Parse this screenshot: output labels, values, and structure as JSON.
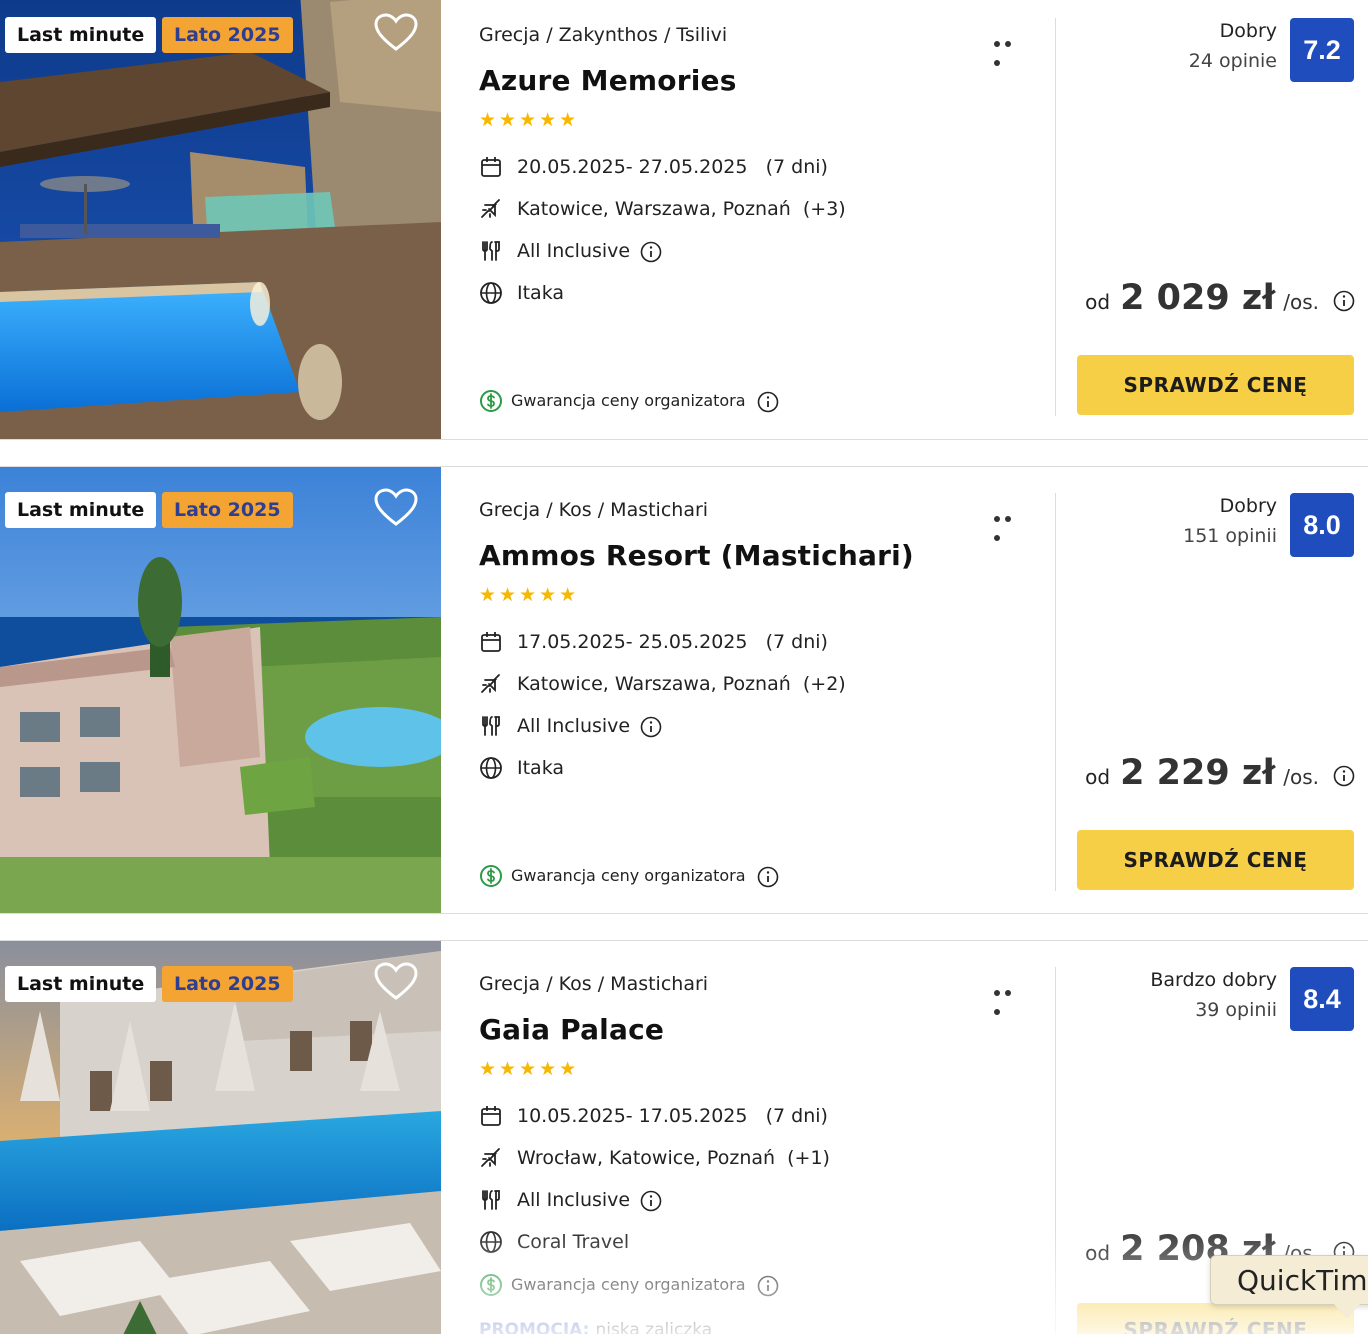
{
  "results": [
    {
      "tags": {
        "last_minute": "Last minute",
        "season": "Lato 2025"
      },
      "location": "Grecja / Zakynthos / Tsilivi",
      "name": "Azure Memories",
      "stars": "★★★★★",
      "dates": "20.05.2025- 27.05.2025",
      "duration": "(7 dni)",
      "departures": "Katowice, Warszawa, Poznań",
      "departures_more": "(+3)",
      "board": "All Inclusive",
      "operator": "Itaka",
      "guarantee": "Gwarancja ceny organizatora",
      "rating_word": "Dobry",
      "rating_count": "24 opinie",
      "score": "7.2",
      "price_prefix": "od",
      "price": "2 029 zł",
      "price_suffix": "/os.",
      "cta": "SPRAWDŹ CENĘ"
    },
    {
      "tags": {
        "last_minute": "Last minute",
        "season": "Lato 2025"
      },
      "location": "Grecja / Kos / Mastichari",
      "name": "Ammos Resort (Mastichari)",
      "stars": "★★★★★",
      "dates": "17.05.2025- 25.05.2025",
      "duration": "(7 dni)",
      "departures": "Katowice, Warszawa, Poznań",
      "departures_more": "(+2)",
      "board": "All Inclusive",
      "operator": "Itaka",
      "guarantee": "Gwarancja ceny organizatora",
      "rating_word": "Dobry",
      "rating_count": "151 opinii",
      "score": "8.0",
      "price_prefix": "od",
      "price": "2 229 zł",
      "price_suffix": "/os.",
      "cta": "SPRAWDŹ CENĘ"
    },
    {
      "tags": {
        "last_minute": "Last minute",
        "season": "Lato 2025"
      },
      "location": "Grecja / Kos / Mastichari",
      "name": "Gaia Palace",
      "stars": "★★★★★",
      "dates": "10.05.2025- 17.05.2025",
      "duration": "(7 dni)",
      "departures": "Wrocław, Katowice, Poznań",
      "departures_more": "(+1)",
      "board": "All Inclusive",
      "operator": "Coral Travel",
      "guarantee": "Gwarancja ceny organizatora",
      "promo_label": "PROMOCJA:",
      "promo_value": "niska zaliczka",
      "rating_word": "Bardzo dobry",
      "rating_count": "39 opinii",
      "score": "8.4",
      "price_prefix": "od",
      "price": "2 208 zł",
      "price_suffix": "/os.",
      "cta": "SPRAWDŹ CENĘ"
    }
  ],
  "tooltip": "QuickTime",
  "colors": {
    "score_bg": "#1f4dbd",
    "cta_bg": "#f7cf46",
    "season_tag_bg": "#f4a433",
    "season_tag_text": "#2e3f91",
    "star": "#f6b800",
    "guarantee_icon": "#2c9a47",
    "promo": "#2e4fb8"
  },
  "icons": [
    "heart-icon",
    "more-icon",
    "calendar-icon",
    "plane-icon",
    "cutlery-icon",
    "globe-icon",
    "info-icon",
    "dollar-icon"
  ]
}
